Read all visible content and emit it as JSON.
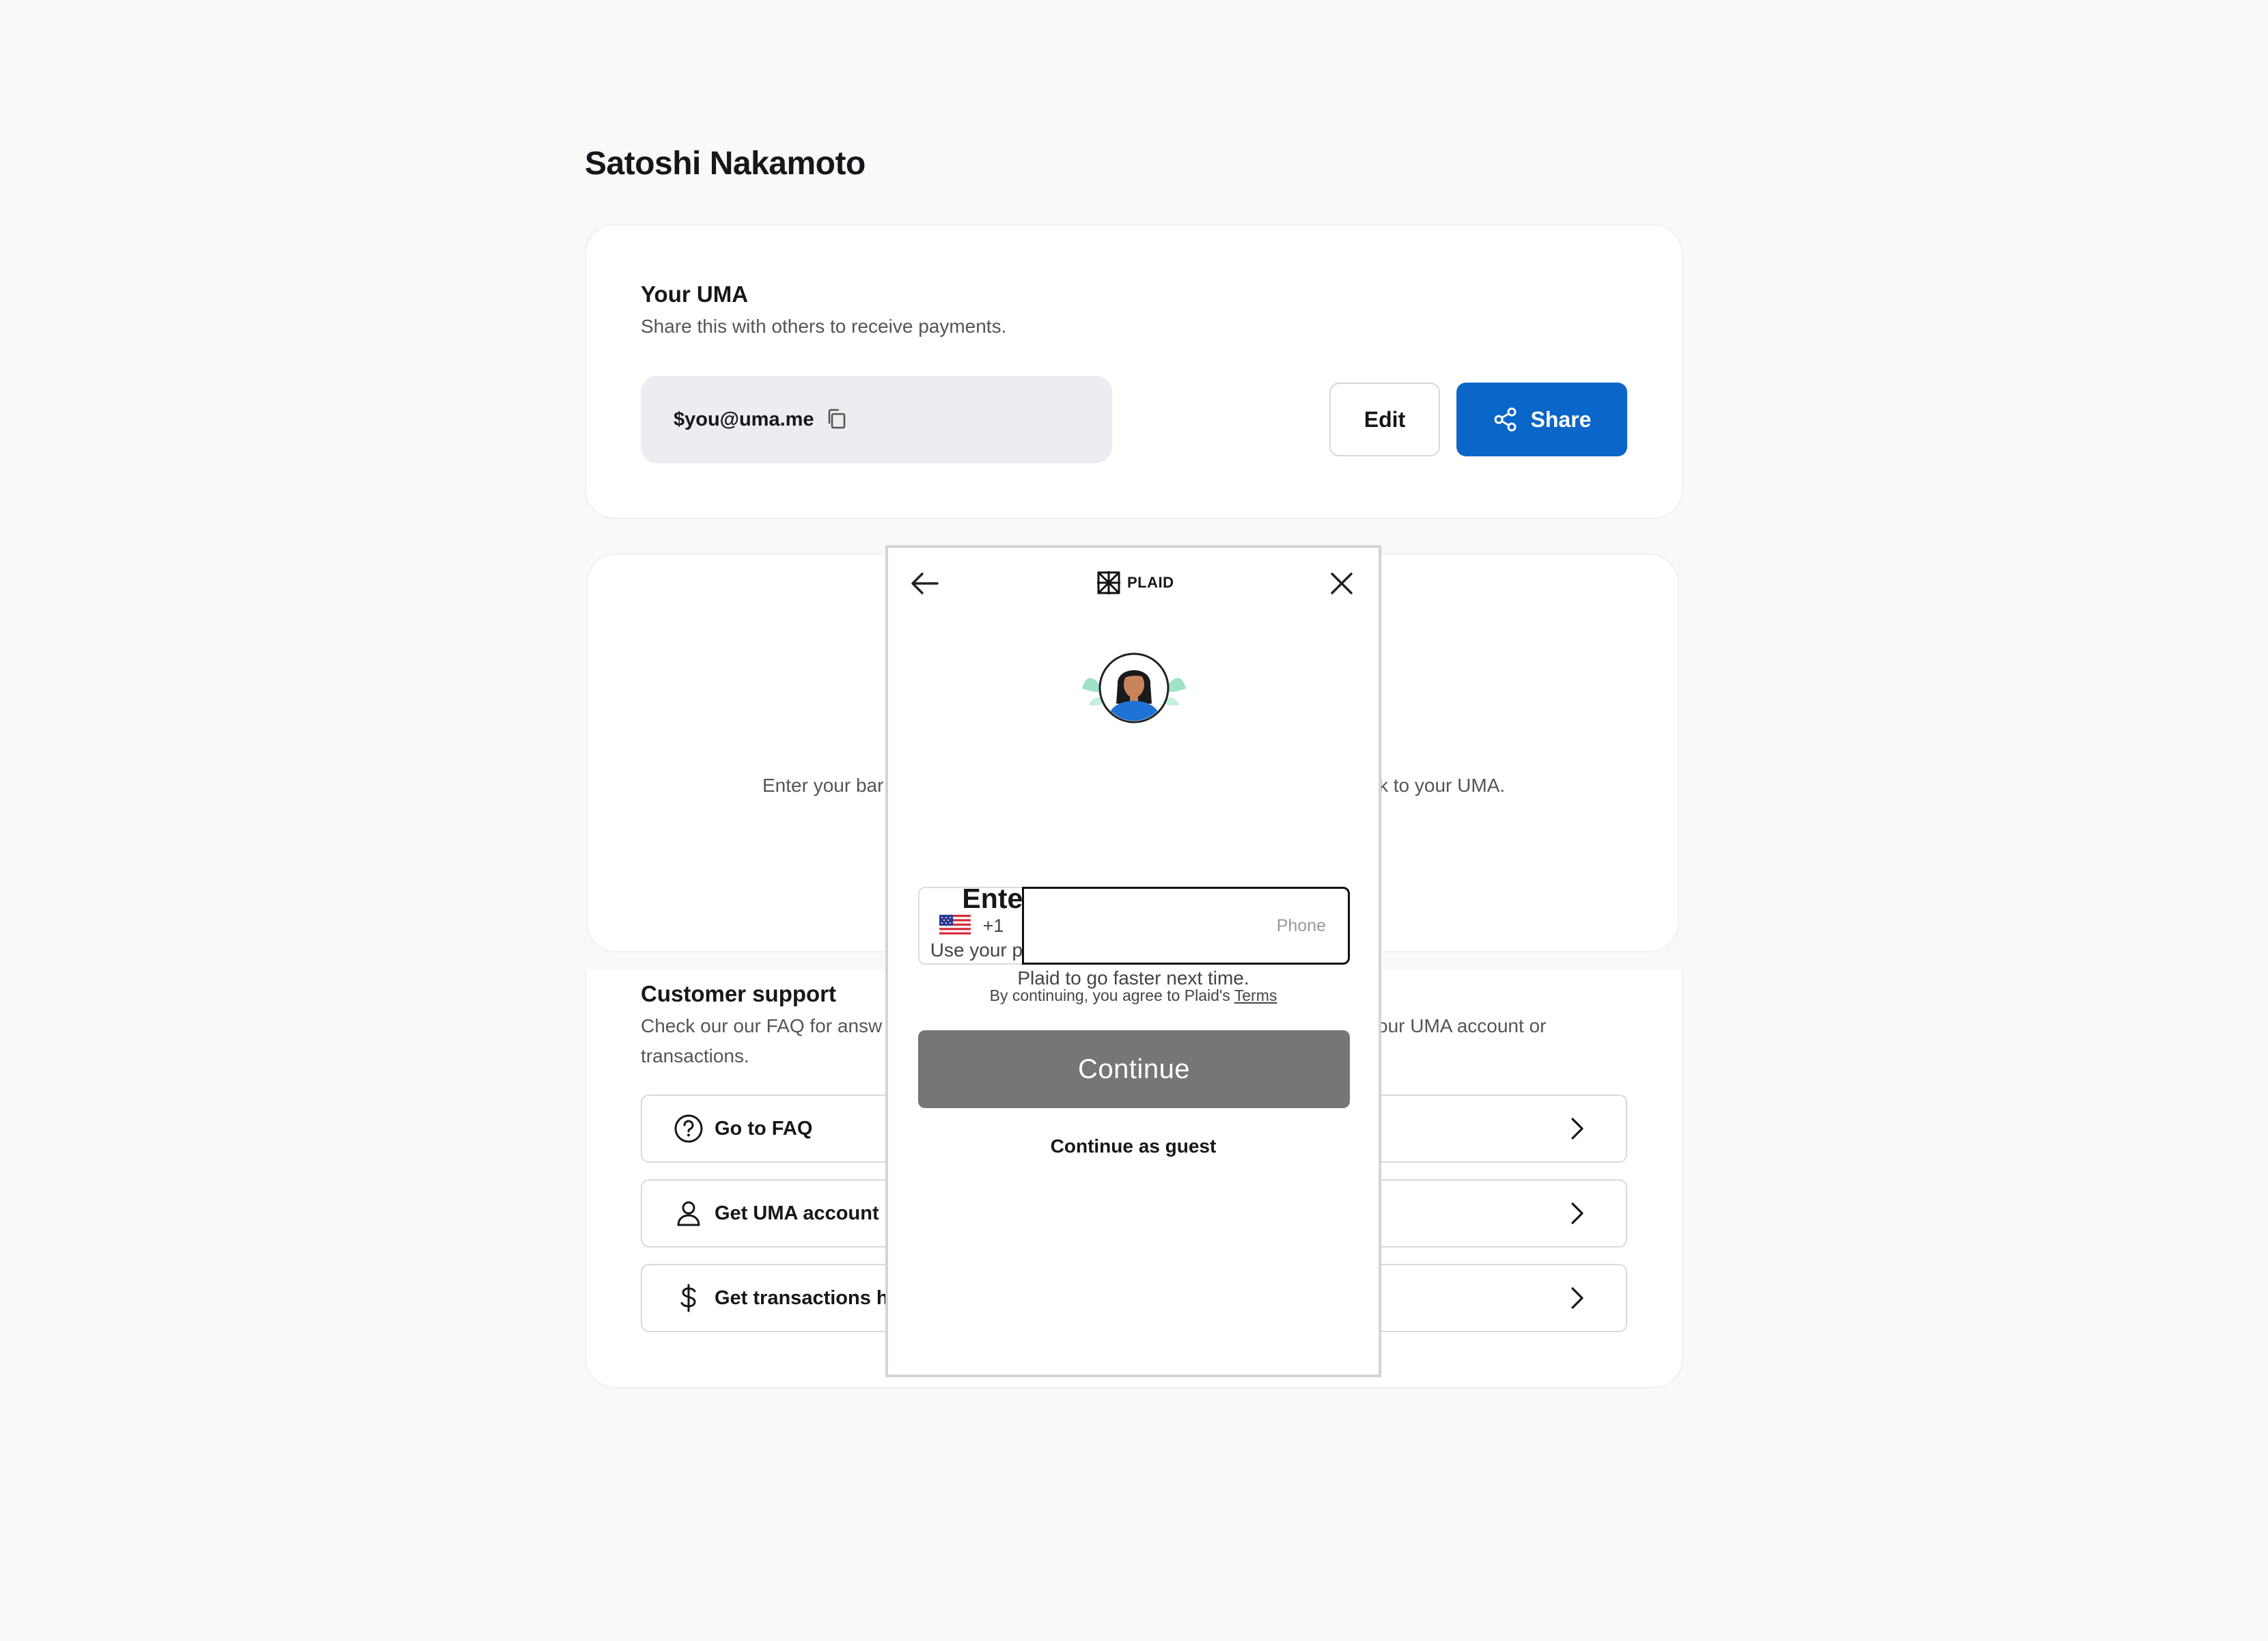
{
  "page": {
    "title": "Satoshi Nakamoto"
  },
  "uma_card": {
    "title": "Your UMA",
    "subtitle": "Share this with others to receive payments.",
    "address": "$you@uma.me",
    "edit_label": "Edit",
    "share_label": "Share"
  },
  "bank_card": {
    "text_left": "Enter your bar",
    "text_right": "k to your UMA."
  },
  "support": {
    "title": "Customer support",
    "desc_line1_left": "Check our our FAQ for answ",
    "desc_line1_right": "our UMA account or",
    "desc_line2": "transactions.",
    "items": [
      {
        "label": "Go to FAQ",
        "icon": "question-circle-icon"
      },
      {
        "label": "Get UMA account h",
        "icon": "user-icon"
      },
      {
        "label": "Get transactions h",
        "icon": "dollar-icon"
      }
    ]
  },
  "plaid": {
    "brand": "PLAID",
    "title": "Enter your phone number",
    "subtitle": "Use your phone number to log in or sign up with Plaid to go faster next time.",
    "country_code": "+1",
    "phone_placeholder": "Phone",
    "phone_value": "",
    "terms_prefix": "By continuing, you agree to Plaid's",
    "terms_link": "Terms",
    "continue_label": "Continue",
    "guest_label": "Continue as guest"
  },
  "colors": {
    "primary": "#0a66c8",
    "continue_disabled": "#767676",
    "background": "#f9f9f9"
  }
}
